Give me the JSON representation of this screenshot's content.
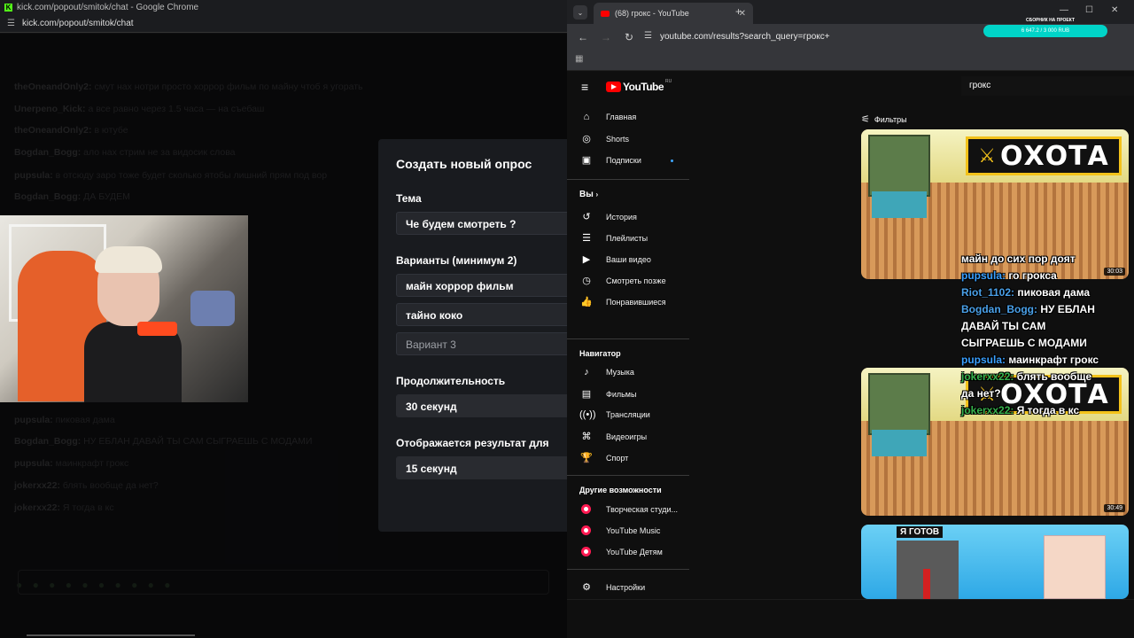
{
  "left_window": {
    "title": "kick.com/popout/smitok/chat - Google Chrome",
    "url": "kick.com/popout/smitok/chat",
    "chat_lines": [
      {
        "user": "theOneandOnly2:",
        "text": "смут нах нотри просто хоррор фильм по майну чтоб я угорать"
      },
      {
        "user": "Unerpeno_Kick:",
        "text": "а все равно через 1.5 часа — на съебаш"
      },
      {
        "user": "theOneandOnly2:",
        "text": "в ютубе"
      },
      {
        "user": "Bogdan_Bogg:",
        "text": "ало нах стрим не за видосик слова"
      },
      {
        "user": "pupsula:",
        "text": "в отсюду заро тоже будет сколько ятобы лишний прям под вор"
      },
      {
        "user": "Bogdan_Bogg:",
        "text": "ДА БУДЕМ"
      }
    ],
    "chat_lines_lower": [
      {
        "user": "pupsula:",
        "text": "пиковая дама"
      },
      {
        "user": "Bogdan_Bogg:",
        "text": "НУ ЕБЛАН ДАВАЙ ТЫ САМ СЫГРАЕШЬ С МОДАМИ"
      },
      {
        "user": "pupsula:",
        "text": "маинкрафт грокс"
      },
      {
        "user": "jokerxx22:",
        "text": "блять вообще да нет?"
      },
      {
        "user": "jokerxx22:",
        "text": "Я тогда в кс"
      }
    ]
  },
  "poll_modal": {
    "title": "Создать новый опрос",
    "topic_label": "Тема",
    "topic_value": "Че будем смотреть ?",
    "options_label": "Варианты (минимум 2)",
    "option1": "майн хоррор фильм",
    "option2": "тайно коко",
    "option3_placeholder": "Вариант 3",
    "duration_label": "Продолжительность",
    "duration_value": "30 секунд",
    "result_label": "Отображается результат для",
    "result_value": "15 секунд"
  },
  "right_window": {
    "tab_title": "(68) грокс - YouTube",
    "url": "youtube.com/results?search_query=грокс+",
    "donation_title": "СБОРНИК НА ПРОЕКТ",
    "donation_progress": "6 647.2 / 3 000 RUB",
    "logo_text": "YouTube",
    "logo_region": "RU",
    "search_value": "грокс",
    "filters_label": "Фильтры",
    "sidebar": {
      "main": [
        "Главная",
        "Shorts",
        "Подписки"
      ],
      "you_header": "Вы",
      "you_items": [
        "История",
        "Плейлисты",
        "Ваши видео",
        "Смотреть позже",
        "Понравившиеся"
      ],
      "nav_header": "Навигатор",
      "nav_items": [
        "Музыка",
        "Фильмы",
        "Трансляции",
        "Видеоигры",
        "Спорт"
      ],
      "more_header": "Другие возможности",
      "more_items": [
        "Творческая студи...",
        "YouTube Music",
        "YouTube Детям"
      ],
      "settings": "Настройки"
    },
    "videos": [
      {
        "title_overlay": "ОХОТА",
        "duration": "30:03"
      },
      {
        "title_overlay": "ОХОТА",
        "duration": "30:49"
      },
      {
        "title_overlay": "Я ГОТОВ",
        "duration": ""
      }
    ],
    "overlay_chat": [
      {
        "user": "",
        "text": "майн до сих пор доят"
      },
      {
        "user": "pupsula:",
        "text": "го грокса"
      },
      {
        "user": "Riot_1102:",
        "text": "пиковая дама"
      },
      {
        "user": "Bogdan_Bogg:",
        "text": "НУ ЕБЛАН"
      },
      {
        "user": "",
        "text": "ДАВАЙ ТЫ САМ"
      },
      {
        "user": "",
        "text": "СЫГРАЕШЬ С МОДАМИ"
      },
      {
        "user": "pupsula:",
        "text": "маинкрафт грокс"
      },
      {
        "user": "jokerxx22:",
        "text": "блять вообще"
      },
      {
        "user": "",
        "text": "да нет?"
      },
      {
        "user": "jokerxx22:",
        "text": "Я тогда в кс"
      }
    ]
  },
  "colors": {
    "kick_green": "#53fc18",
    "youtube_red": "#ff0000",
    "modal_bg": "#191b1f",
    "donation_teal": "#00d4c8"
  }
}
